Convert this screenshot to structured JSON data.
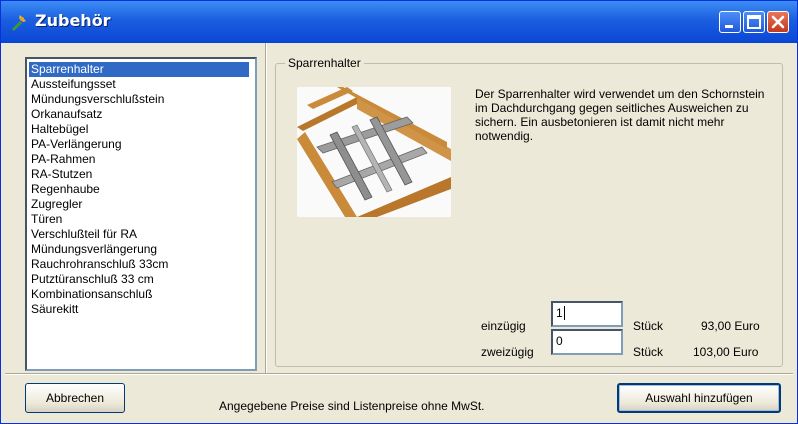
{
  "window": {
    "title": "Zubehör"
  },
  "list": {
    "items": [
      "Sparrenhalter",
      "Aussteifungsset",
      "Mündungsverschlußstein",
      "Orkanaufsatz",
      "Haltebügel",
      "PA-Verlängerung",
      "PA-Rahmen",
      "RA-Stutzen",
      "Regenhaube",
      "Zugregler",
      "Türen",
      "Verschlußteil für RA",
      "Mündungsverlängerung",
      "Rauchrohranschluß 33cm",
      "Putztüranschluß 33 cm",
      "Kombinationsanschluß",
      "Säurekitt"
    ],
    "selected": "Sparrenhalter"
  },
  "detail": {
    "group_title": "Sparrenhalter",
    "description": "Der Sparrenhalter wird verwendet um den Schornstein im Dachdurchgang gegen seitliches Ausweichen zu sichern. Ein ausbetonieren ist damit nicht mehr notwendig.",
    "rows": [
      {
        "label": "einzügig",
        "value": "1",
        "unit": "Stück",
        "price": "93,00 Euro"
      },
      {
        "label": "zweizügig",
        "value": "0",
        "unit": "Stück",
        "price": "103,00 Euro"
      }
    ]
  },
  "footer": {
    "cancel_label": "Abbrechen",
    "note": "Angegebene Preise sind Listenpreise ohne MwSt.",
    "add_label": "Auswahl hinzufügen"
  },
  "icons": {
    "app": "tool-icon",
    "minimize": "minimize-icon",
    "maximize": "maximize-icon",
    "close": "close-icon"
  }
}
